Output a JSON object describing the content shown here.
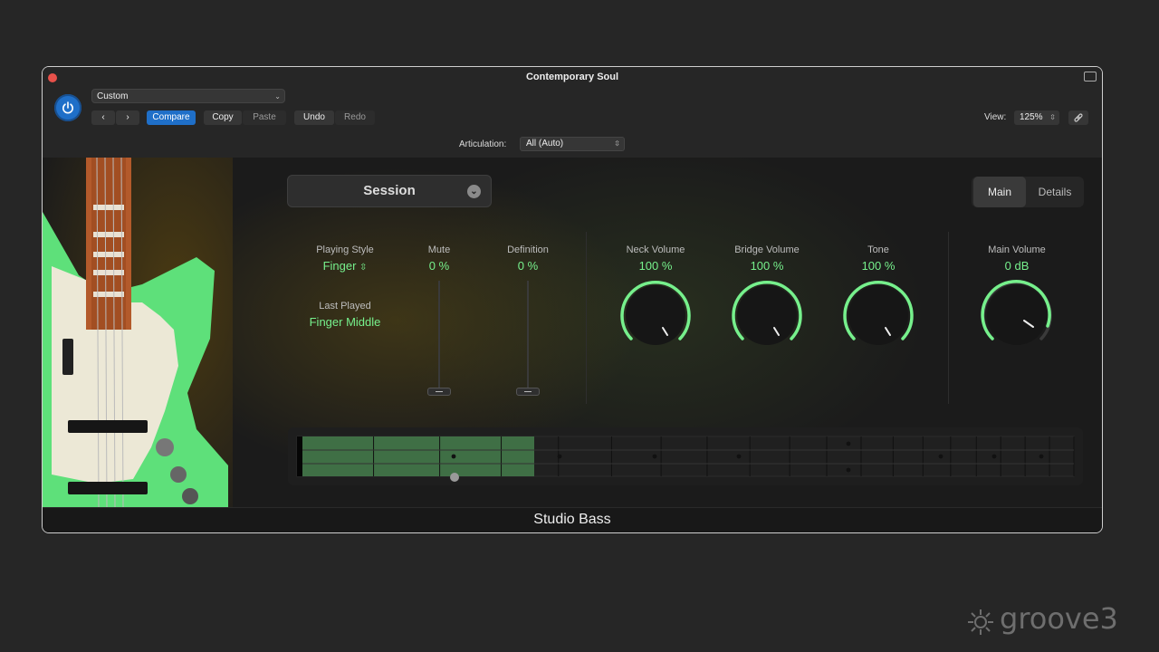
{
  "window": {
    "title": "Contemporary Soul"
  },
  "header": {
    "preset": "Custom",
    "buttons": {
      "compare": "Compare",
      "copy": "Copy",
      "paste": "Paste",
      "undo": "Undo",
      "redo": "Redo"
    },
    "articulation_label": "Articulation:",
    "articulation_value": "All (Auto)",
    "view_label": "View:",
    "view_value": "125%"
  },
  "plugin": {
    "session_label": "Session",
    "tabs": [
      "Main",
      "Details"
    ],
    "active_tab": "Main",
    "playing_style": {
      "label": "Playing Style",
      "value": "Finger"
    },
    "last_played": {
      "label": "Last Played",
      "value": "Finger Middle"
    },
    "mute": {
      "label": "Mute",
      "value": "0 %"
    },
    "definition": {
      "label": "Definition",
      "value": "0 %"
    },
    "neck_volume": {
      "label": "Neck Volume",
      "value": "100 %"
    },
    "bridge_volume": {
      "label": "Bridge Volume",
      "value": "100 %"
    },
    "tone": {
      "label": "Tone",
      "value": "100 %"
    },
    "main_volume": {
      "label": "Main Volume",
      "value": "0 dB"
    },
    "fretboard": {
      "frets": 19,
      "active_frets": 4,
      "dot_frets": [
        3,
        5,
        7,
        9,
        12,
        15,
        17,
        19
      ]
    }
  },
  "footer": {
    "instrument": "Studio Bass"
  },
  "watermark": "groove3",
  "colors": {
    "accent_green": "#76f08c",
    "power_blue": "#1f6fc8",
    "body_green": "#5ee07a"
  }
}
